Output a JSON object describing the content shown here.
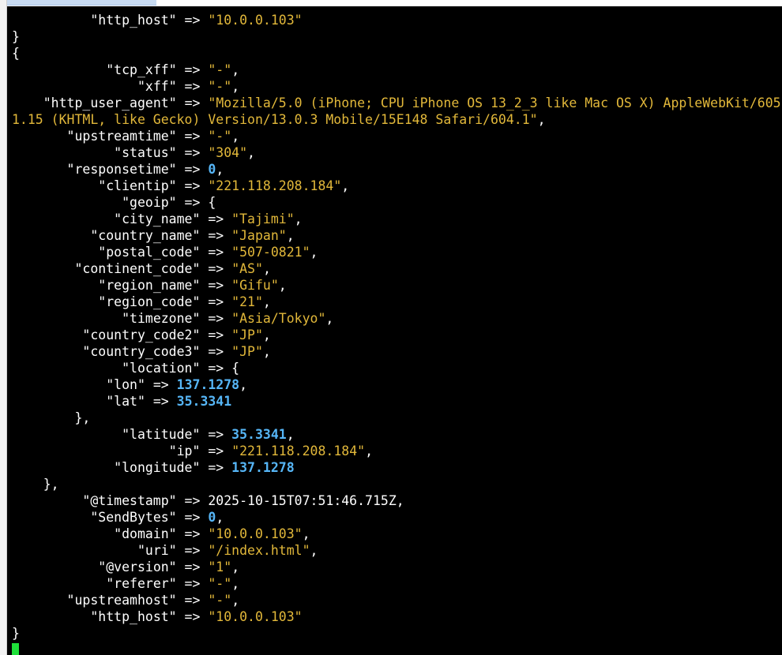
{
  "terminal": {
    "lines": [
      {
        "indent": "          ",
        "key": "\"http_host\"",
        "str": "\"10.0.0.103\""
      },
      {
        "punct": "}"
      },
      {
        "punct": "{"
      },
      {
        "indent": "            ",
        "key": "\"tcp_xff\"",
        "str": "\"-\"",
        "trail": ","
      },
      {
        "indent": "                ",
        "key": "\"xff\"",
        "str": "\"-\"",
        "trail": ","
      },
      {
        "indent": "    ",
        "key": "\"http_user_agent\"",
        "str": "\"Mozilla/5.0 (iPhone; CPU iPhone OS 13_2_3 like Mac OS X) AppleWebKit/605"
      },
      {
        "str": "1.15 (KHTML, like Gecko) Version/13.0.3 Mobile/15E148 Safari/604.1\"",
        "trail": ","
      },
      {
        "indent": "       ",
        "key": "\"upstreamtime\"",
        "str": "\"-\"",
        "trail": ","
      },
      {
        "indent": "             ",
        "key": "\"status\"",
        "str": "\"304\"",
        "trail": ","
      },
      {
        "indent": "       ",
        "key": "\"responsetime\"",
        "num": "0",
        "trail": ","
      },
      {
        "indent": "           ",
        "key": "\"clientip\"",
        "str": "\"221.118.208.184\"",
        "trail": ","
      },
      {
        "indent": "              ",
        "key": "\"geoip\"",
        "open": "{"
      },
      {
        "indent": "             ",
        "key": "\"city_name\"",
        "str": "\"Tajimi\"",
        "trail": ","
      },
      {
        "indent": "          ",
        "key": "\"country_name\"",
        "str": "\"Japan\"",
        "trail": ","
      },
      {
        "indent": "           ",
        "key": "\"postal_code\"",
        "str": "\"507-0821\"",
        "trail": ","
      },
      {
        "indent": "        ",
        "key": "\"continent_code\"",
        "str": "\"AS\"",
        "trail": ","
      },
      {
        "indent": "           ",
        "key": "\"region_name\"",
        "str": "\"Gifu\"",
        "trail": ","
      },
      {
        "indent": "           ",
        "key": "\"region_code\"",
        "str": "\"21\"",
        "trail": ","
      },
      {
        "indent": "              ",
        "key": "\"timezone\"",
        "str": "\"Asia/Tokyo\"",
        "trail": ","
      },
      {
        "indent": "         ",
        "key": "\"country_code2\"",
        "str": "\"JP\"",
        "trail": ","
      },
      {
        "indent": "         ",
        "key": "\"country_code3\"",
        "str": "\"JP\"",
        "trail": ","
      },
      {
        "indent": "              ",
        "key": "\"location\"",
        "open": "{"
      },
      {
        "indent": "            ",
        "key": "\"lon\"",
        "num": "137.1278",
        "trail": ","
      },
      {
        "indent": "            ",
        "key": "\"lat\"",
        "num": "35.3341"
      },
      {
        "indent": "        ",
        "punct": "},"
      },
      {
        "indent": "              ",
        "key": "\"latitude\"",
        "num": "35.3341",
        "trail": ","
      },
      {
        "indent": "                    ",
        "key": "\"ip\"",
        "str": "\"221.118.208.184\"",
        "trail": ","
      },
      {
        "indent": "             ",
        "key": "\"longitude\"",
        "num": "137.1278"
      },
      {
        "indent": "    ",
        "punct": "},"
      },
      {
        "indent": "         ",
        "key": "\"@timestamp\"",
        "plain": "2025-10-15T07:51:46.715Z",
        "trail": ","
      },
      {
        "indent": "          ",
        "key": "\"SendBytes\"",
        "num": "0",
        "trail": ","
      },
      {
        "indent": "             ",
        "key": "\"domain\"",
        "str": "\"10.0.0.103\"",
        "trail": ","
      },
      {
        "indent": "                ",
        "key": "\"uri\"",
        "str": "\"/index.html\"",
        "trail": ","
      },
      {
        "indent": "           ",
        "key": "\"@version\"",
        "str": "\"1\"",
        "trail": ","
      },
      {
        "indent": "            ",
        "key": "\"referer\"",
        "str": "\"-\"",
        "trail": ","
      },
      {
        "indent": "       ",
        "key": "\"upstreamhost\"",
        "str": "\"-\"",
        "trail": ","
      },
      {
        "indent": "          ",
        "key": "\"http_host\"",
        "str": "\"10.0.0.103\""
      },
      {
        "punct": "}"
      },
      {
        "cursor": true
      }
    ],
    "arrow": "=>",
    "colors": {
      "background": "#000000",
      "key": "#ffffff",
      "string": "#e2b83a",
      "number": "#56b6f7",
      "cursor": "#1fe03a"
    }
  }
}
